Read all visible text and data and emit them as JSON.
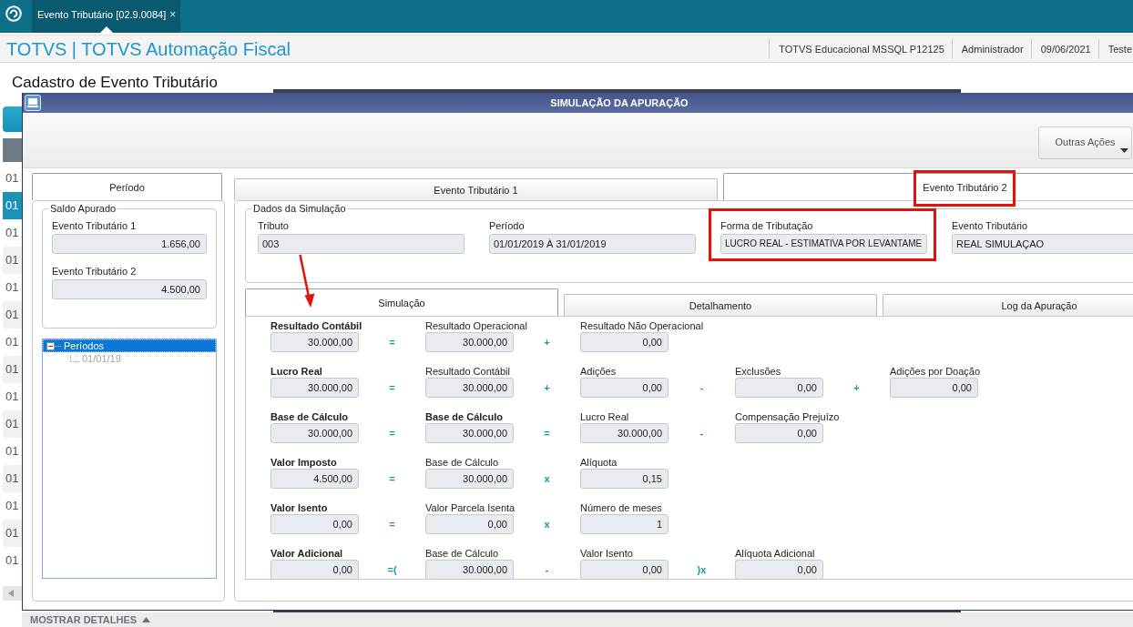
{
  "top_bar": {
    "tabs": [
      {
        "label": "Evento Tributário [02.9.0084]",
        "close": "×",
        "selected": true
      }
    ]
  },
  "header": {
    "title": "TOTVS | TOTVS Automação Fiscal",
    "info": [
      "TOTVS Educacional MSSQL P12125",
      "Administrador",
      "09/06/2021",
      "Teste"
    ]
  },
  "page": {
    "title": "Cadastro de Evento Tributário",
    "rows": [
      {
        "cell": "01",
        "selected": false
      },
      {
        "cell": "01",
        "selected": true
      },
      {
        "cell": "01",
        "selected": false
      },
      {
        "cell": "01",
        "selected": false
      },
      {
        "cell": "01",
        "selected": false
      },
      {
        "cell": "01",
        "selected": false
      },
      {
        "cell": "01",
        "selected": false
      },
      {
        "cell": "01",
        "selected": false
      },
      {
        "cell": "01",
        "selected": false
      },
      {
        "cell": "01",
        "selected": false
      },
      {
        "cell": "01",
        "selected": false
      },
      {
        "cell": "01",
        "selected": false
      },
      {
        "cell": "01",
        "selected": false
      },
      {
        "cell": "01",
        "selected": false
      },
      {
        "cell": "01",
        "selected": false
      }
    ],
    "footer": {
      "label": "MOSTRAR DETALHES"
    }
  },
  "dialog": {
    "title": "SIMULAÇÃO DA APURAÇÃO",
    "toolbar": {
      "button": "Outras Ações"
    },
    "left_panel": {
      "tab": {
        "label": "Período",
        "selected": true
      },
      "legend": "Saldo Apurado",
      "fields": [
        {
          "label": "Evento Tributário 1",
          "value": "1.656,00"
        },
        {
          "label": "Evento Tributário 2",
          "value": "4.500,00"
        }
      ],
      "tree": [
        {
          "label": "Períodos",
          "expanded": true,
          "selected": true,
          "children": [
            {
              "label": "01/01/19",
              "selected": false
            }
          ]
        }
      ]
    },
    "tabs": [
      {
        "label": "Evento Tributário 1",
        "selected": false,
        "highlighted": false
      },
      {
        "label": "Evento Tributário 2",
        "selected": true,
        "highlighted": true
      }
    ],
    "simulation_data": {
      "legend": "Dados da Simulação",
      "fields": [
        {
          "label": "Tributo",
          "value": "003",
          "highlighted": false
        },
        {
          "label": "Período",
          "value": "01/01/2019 À 31/01/2019",
          "highlighted": false
        },
        {
          "label": "Forma de Tributação",
          "value": "LUCRO REAL - ESTIMATIVA POR LEVANTAME",
          "highlighted": true
        },
        {
          "label": "Evento Tributário",
          "value": "REAL SIMULAÇAO",
          "highlighted": false
        }
      ]
    },
    "inner_tabs": [
      {
        "label": "Simulação",
        "selected": true
      },
      {
        "label": "Detalhamento",
        "selected": false
      },
      {
        "label": "Log da Apuração",
        "selected": false
      }
    ],
    "formulas": [
      {
        "items": [
          {
            "kind": "result",
            "label": "Resultado Contábil",
            "value": "30.000,00"
          },
          {
            "kind": "operator",
            "symbol": "="
          },
          {
            "kind": "operand",
            "label": "Resultado Operacional",
            "value": "30.000,00"
          },
          {
            "kind": "operator",
            "symbol": "+"
          },
          {
            "kind": "operand",
            "label": "Resultado Não Operacional",
            "value": "0,00"
          }
        ]
      },
      {
        "items": [
          {
            "kind": "result",
            "label": "Lucro Real",
            "value": "30.000,00"
          },
          {
            "kind": "operator",
            "symbol": "="
          },
          {
            "kind": "operand",
            "label": "Resultado Contábil",
            "value": "30.000,00"
          },
          {
            "kind": "operator",
            "symbol": "+"
          },
          {
            "kind": "operand",
            "label": "Adições",
            "value": "0,00"
          },
          {
            "kind": "operator",
            "symbol": "-"
          },
          {
            "kind": "operand",
            "label": "Exclusões",
            "value": "0,00"
          },
          {
            "kind": "operator",
            "symbol": "+"
          },
          {
            "kind": "operand",
            "label": "Adições por Doação",
            "value": "0,00"
          }
        ]
      },
      {
        "items": [
          {
            "kind": "result",
            "label": "Base de Cálculo",
            "value": "30.000,00"
          },
          {
            "kind": "operator",
            "symbol": "="
          },
          {
            "kind": "result",
            "label": "Base de Cálculo",
            "value": "30.000,00"
          },
          {
            "kind": "operator",
            "symbol": "="
          },
          {
            "kind": "operand",
            "label": "Lucro Real",
            "value": "30.000,00"
          },
          {
            "kind": "operator",
            "symbol": "-"
          },
          {
            "kind": "operand",
            "label": "Compensação Prejuízo",
            "value": "0,00"
          }
        ]
      },
      {
        "items": [
          {
            "kind": "result",
            "label": "Valor Imposto",
            "value": "4.500,00"
          },
          {
            "kind": "operator",
            "symbol": "="
          },
          {
            "kind": "operand",
            "label": "Base de Cálculo",
            "value": "30.000,00"
          },
          {
            "kind": "operator",
            "symbol": "x"
          },
          {
            "kind": "operand",
            "label": "Alíquota",
            "value": "0,15"
          }
        ]
      },
      {
        "items": [
          {
            "kind": "result",
            "label": "Valor Isento",
            "value": "0,00"
          },
          {
            "kind": "operator",
            "symbol": "="
          },
          {
            "kind": "operand",
            "label": "Valor Parcela Isenta",
            "value": "0,00"
          },
          {
            "kind": "operator",
            "symbol": "x"
          },
          {
            "kind": "operand",
            "label": "Número de meses",
            "value": "1"
          }
        ]
      },
      {
        "items": [
          {
            "kind": "result",
            "label": "Valor Adicional",
            "value": "0,00"
          },
          {
            "kind": "operator",
            "symbol": "=("
          },
          {
            "kind": "operand",
            "label": "Base de Cálculo",
            "value": "30.000,00"
          },
          {
            "kind": "operator",
            "symbol": "-"
          },
          {
            "kind": "operand",
            "label": "Valor Isento",
            "value": "0,00"
          },
          {
            "kind": "operator",
            "symbol": ")x"
          },
          {
            "kind": "operand",
            "label": "Alíquota Adicional",
            "value": "0,00"
          }
        ]
      }
    ]
  }
}
